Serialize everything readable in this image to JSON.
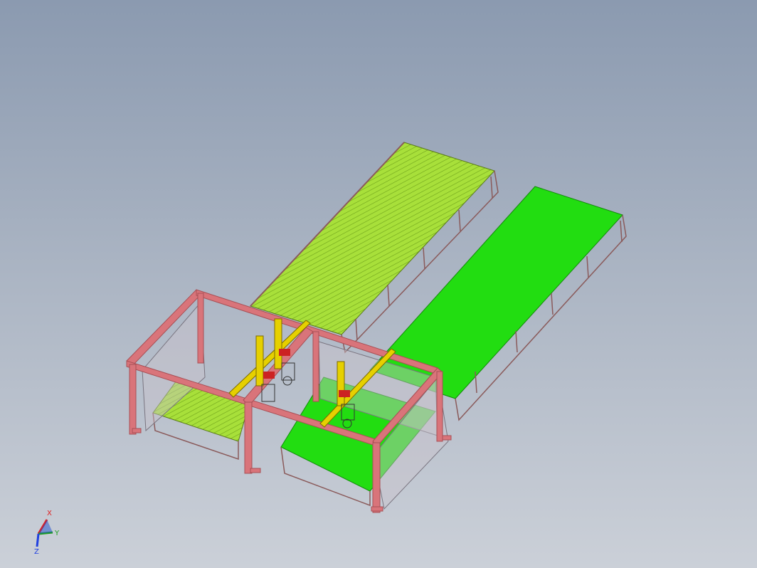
{
  "viewport": {
    "background_top": "#8b9ab0",
    "background_bottom": "#cbd0d8"
  },
  "colors": {
    "frame": "#d9747a",
    "frame_dark": "#a84f55",
    "conveyor_striped": "#a8e03a",
    "conveyor_stripe_line": "#6fa21a",
    "conveyor_solid": "#22dd11",
    "gantry_rail": "#e6d000",
    "gantry_dark": "#7a6a00",
    "panel": "#c9c4cc"
  },
  "triad": {
    "x_label": "X",
    "y_label": "Y",
    "z_label": "Z",
    "x_color": "#e02020",
    "y_color": "#20a020",
    "z_color": "#2040e0",
    "icon": "coordinate-triad-icon"
  }
}
